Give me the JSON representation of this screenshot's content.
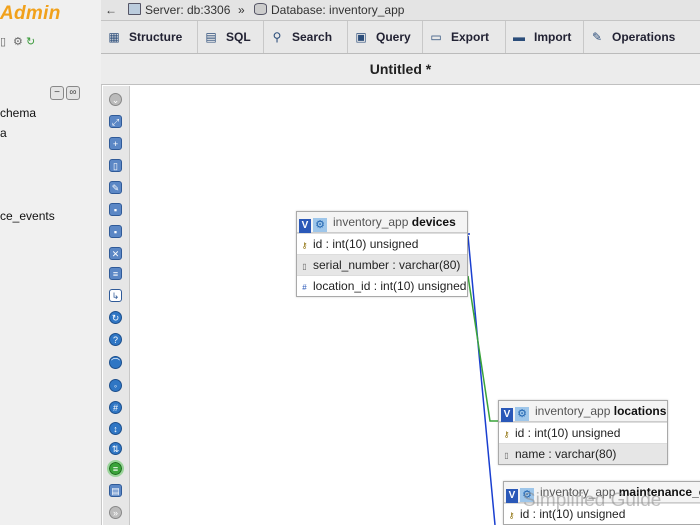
{
  "nav": {
    "logo": "Admin",
    "items": [
      "chema",
      "ce_events"
    ]
  },
  "topbar": {
    "server_label": "Server: db:3306",
    "separator": "»",
    "database_label": "Database: inventory_app"
  },
  "tabs": [
    {
      "label": "Structure",
      "icon": "structure-icon"
    },
    {
      "label": "SQL",
      "icon": "sql-icon"
    },
    {
      "label": "Search",
      "icon": "search-icon"
    },
    {
      "label": "Query",
      "icon": "query-icon"
    },
    {
      "label": "Export",
      "icon": "export-icon"
    },
    {
      "label": "Import",
      "icon": "import-icon"
    },
    {
      "label": "Operations",
      "icon": "wrench-icon"
    }
  ],
  "designer": {
    "title": "Untitled *",
    "tables": [
      {
        "db": "inventory_app",
        "name": "devices",
        "columns": [
          "id : int(10) unsigned",
          "serial_number : varchar(80)",
          "location_id : int(10) unsigned"
        ]
      },
      {
        "db": "inventory_app",
        "name": "locations",
        "columns": [
          "id : int(10) unsigned",
          "name : varchar(80)"
        ]
      },
      {
        "db": "inventory_app",
        "name": "maintenance_e",
        "columns": [
          "id : int(10) unsigned"
        ]
      }
    ]
  },
  "watermark": "Simplified Guide",
  "colors": {
    "logo": "#f1a11b",
    "relation_primary": "#1a3fd0",
    "relation_secondary": "#3aa33a"
  }
}
